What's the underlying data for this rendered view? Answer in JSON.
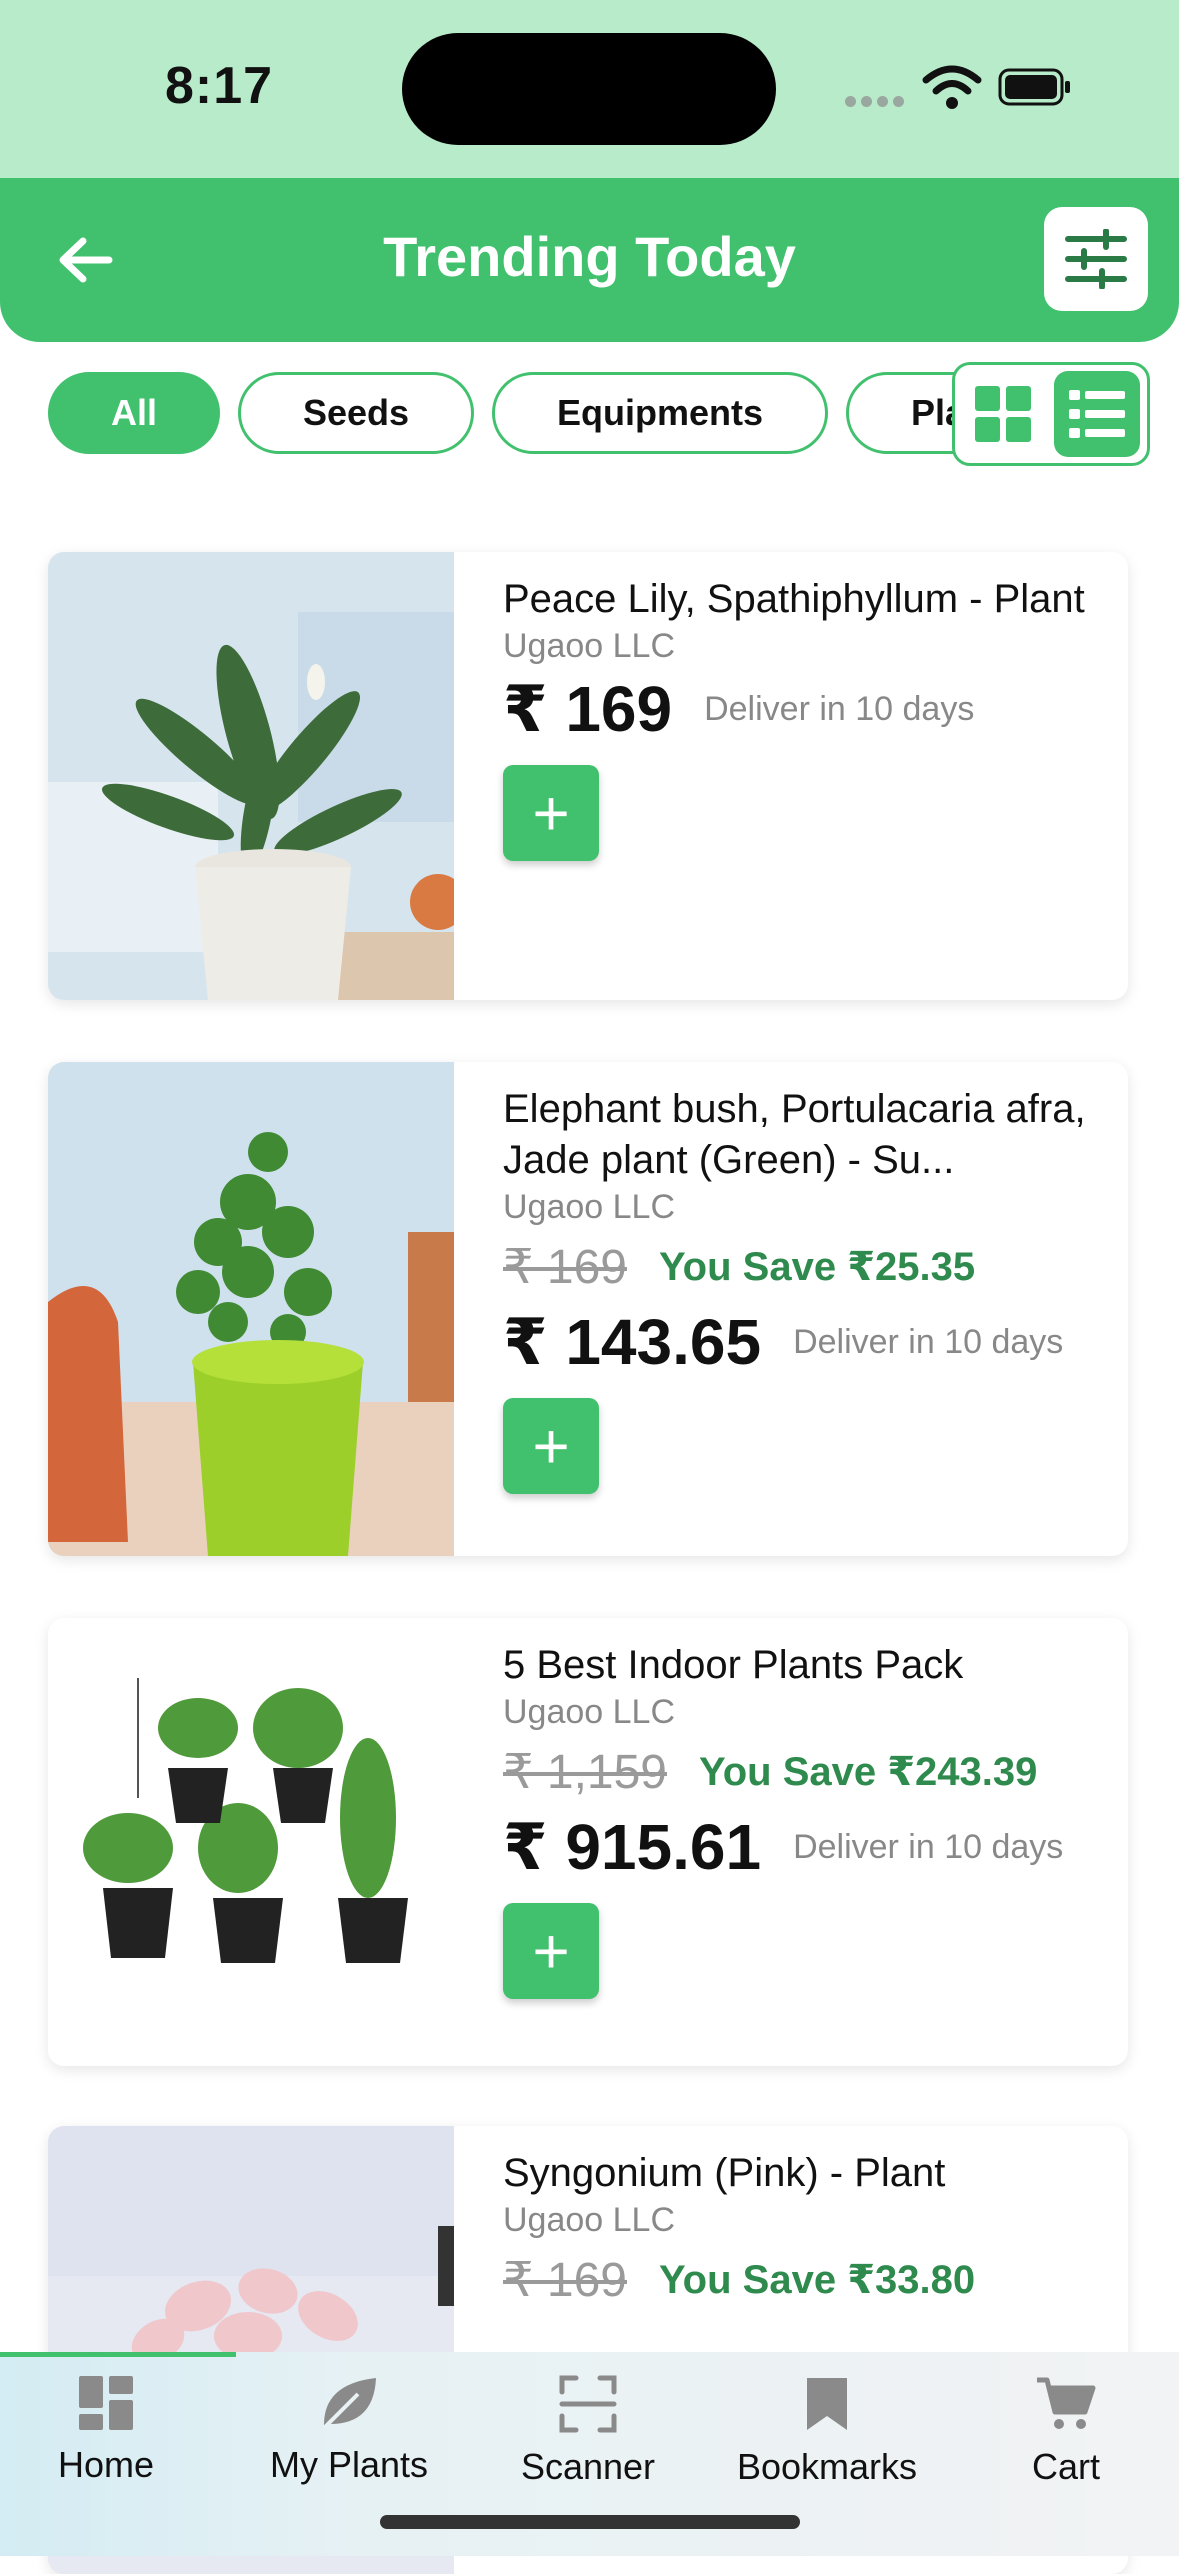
{
  "status_bar": {
    "time": "8:17"
  },
  "header": {
    "title": "Trending Today"
  },
  "filters": [
    "All",
    "Seeds",
    "Equipments",
    "Plants"
  ],
  "products": [
    {
      "name": "Peace Lily, Spathiphyllum - Plant",
      "seller": "Ugaoo LLC",
      "price": "₹ 169",
      "delivery": "Deliver in 10 days",
      "add_label": "+"
    },
    {
      "name": "Elephant bush, Portulacaria afra, Jade plant (Green) - Su...",
      "seller": "Ugaoo LLC",
      "original_price": "₹ 169",
      "savings": "You Save ₹25.35",
      "price": "₹ 143.65",
      "delivery": "Deliver in 10 days",
      "add_label": "+"
    },
    {
      "name": "5 Best Indoor Plants Pack",
      "seller": "Ugaoo LLC",
      "original_price": "₹ 1,159",
      "savings": "You Save ₹243.39",
      "price": "₹ 915.61",
      "delivery": "Deliver in 10 days",
      "add_label": "+"
    },
    {
      "name": "Syngonium (Pink) - Plant",
      "seller": "Ugaoo LLC",
      "original_price": "₹ 169",
      "savings": "You Save ₹33.80"
    }
  ],
  "tabs": [
    {
      "label": "Home",
      "icon": "home-icon"
    },
    {
      "label": "My Plants",
      "icon": "leaf-icon"
    },
    {
      "label": "Scanner",
      "icon": "scanner-icon"
    },
    {
      "label": "Bookmarks",
      "icon": "bookmark-icon"
    },
    {
      "label": "Cart",
      "icon": "cart-icon"
    }
  ],
  "colors": {
    "accent": "#41c16e",
    "status_bg": "#b7ebc9",
    "savings": "#2f8a4e"
  }
}
